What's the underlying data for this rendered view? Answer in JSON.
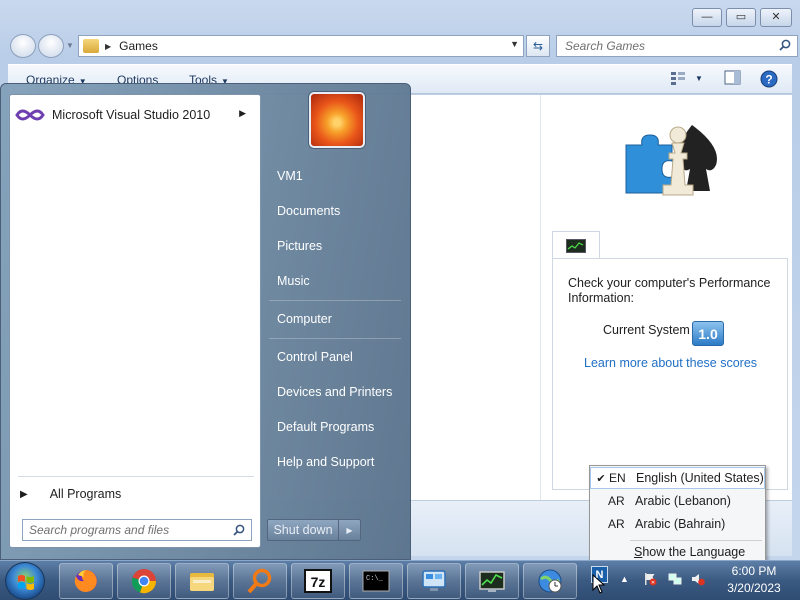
{
  "explorer": {
    "address_path": "Games",
    "search_placeholder": "Search Games",
    "menu": {
      "organize": "Organize",
      "options": "Options",
      "tools": "Tools"
    }
  },
  "performance": {
    "title": "Check your computer's Performance Information:",
    "current_label": "Current System",
    "score": "1.0",
    "link": "Learn more about these scores"
  },
  "start_menu": {
    "pinned": [
      {
        "label": "Microsoft Visual Studio 2010",
        "icon": "visual-studio-icon"
      }
    ],
    "all_programs": "All Programs",
    "search_placeholder": "Search programs and files",
    "right_items": {
      "user": "VM1",
      "documents": "Documents",
      "pictures": "Pictures",
      "music": "Music",
      "computer": "Computer",
      "control_panel": "Control Panel",
      "devices_printers": "Devices and Printers",
      "default_programs": "Default Programs",
      "help_support": "Help and Support"
    },
    "shutdown": "Shut down"
  },
  "language_menu": {
    "items": [
      {
        "code": "EN",
        "name": "English (United States)",
        "checked": true
      },
      {
        "code": "AR",
        "name": "Arabic (Lebanon)",
        "checked": false
      },
      {
        "code": "AR",
        "name": "Arabic (Bahrain)",
        "checked": false
      }
    ],
    "show_bar": "Show the Language bar",
    "indicator": "N"
  },
  "taskbar": {
    "apps": [
      "firefox-icon",
      "chrome-icon",
      "file-explorer-icon",
      "search-tool-icon",
      "7zip-icon",
      "command-prompt-icon",
      "remote-desktop-icon",
      "performance-monitor-icon",
      "internet-clock-icon"
    ],
    "app_7zip_label": "7z",
    "app_cmd_label": "C:\\_",
    "time": "6:00 PM",
    "date": "3/20/2023"
  },
  "colors": {
    "link": "#1f6fc5",
    "taskbar": "#3b5a82",
    "start_menu": "#6f8aa6"
  }
}
